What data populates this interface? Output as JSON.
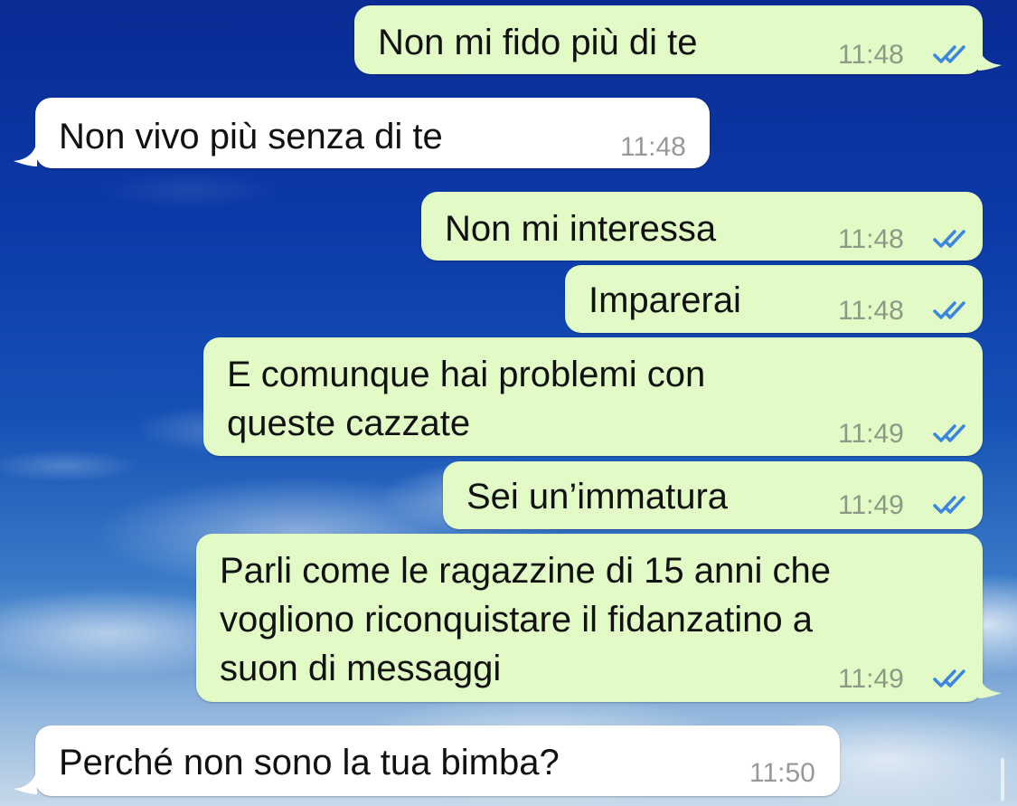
{
  "messages": [
    {
      "text": "Non mi fido più di te",
      "time": "11:48",
      "direction": "outgoing",
      "status": "read"
    },
    {
      "text": "Non vivo più senza di te",
      "time": "11:48",
      "direction": "incoming"
    },
    {
      "text": "Non mi interessa",
      "time": "11:48",
      "direction": "outgoing",
      "status": "read"
    },
    {
      "text": "Imparerai",
      "time": "11:48",
      "direction": "outgoing",
      "status": "read"
    },
    {
      "text": "E comunque hai problemi con\nqueste cazzate",
      "time": "11:49",
      "direction": "outgoing",
      "status": "read"
    },
    {
      "text": "Sei un’immatura",
      "time": "11:49",
      "direction": "outgoing",
      "status": "read"
    },
    {
      "text": "Parli come le ragazzine di 15 anni che\nvogliono riconquistare il fidanzatino a\nsuon di messaggi",
      "time": "11:49",
      "direction": "outgoing",
      "status": "read"
    },
    {
      "text": "Perché non sono la tua bimba?",
      "time": "11:50",
      "direction": "incoming"
    }
  ],
  "colors": {
    "outgoing_bubble": "#e2fbc6",
    "incoming_bubble": "#ffffff",
    "read_ticks": "#3b86e0"
  },
  "icons": {
    "read_status": "double-check-icon"
  }
}
